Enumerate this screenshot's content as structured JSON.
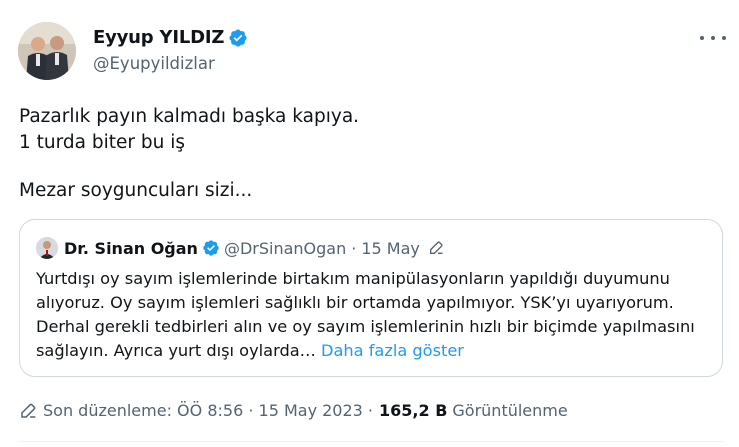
{
  "author": {
    "name": "Eyyup YILDIZ",
    "handle": "@Eyupyildizlar"
  },
  "tweet": {
    "lines": [
      "Pazarlık payın kalmadı başka kapıya.",
      "1  turda biter bu iş",
      "",
      "Mezar soyguncuları sizi..."
    ]
  },
  "quote": {
    "name": "Dr. Sinan Oğan",
    "handle": "@DrSinanOgan",
    "separator": "·",
    "date": "15 May",
    "text": "Yurtdışı oy sayım işlemlerinde birtakım manipülasyonların yapıldığı duyumunu alıyoruz. Oy sayım işlemleri sağlıklı bir ortamda yapılmıyor. YSK’yı uyarıyorum. Derhal gerekli tedbirleri alın ve oy sayım işlemlerinin hızlı bir biçimde yapılmasını sağlayın. Ayrıca yurt dışı oylarda…",
    "show_more": "Daha fazla göster"
  },
  "meta": {
    "edited_label": "Son düzenleme: ÖÖ 8:56 · 15 May 2023 ·",
    "views_count": "165,2 B",
    "views_label": "Görüntülenme"
  },
  "colors": {
    "verified": "#1d9bf0",
    "link": "#1d9bf0",
    "secondary_text": "#536471",
    "border": "#cfd9de"
  },
  "icons": [
    "verified-badge-icon",
    "more-icon",
    "edit-icon",
    "pencil-icon"
  ]
}
